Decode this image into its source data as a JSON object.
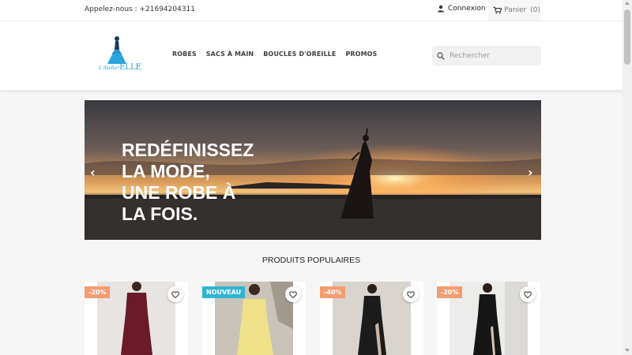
{
  "topbar": {
    "phone_text": "Appelez-nous : +21694204311",
    "login_label": "Connexion",
    "cart_label": "Panier",
    "cart_count": "(0)"
  },
  "header": {
    "logo_small": "L'Atelier",
    "logo_main": "ELLE",
    "nav": [
      "ROBES",
      "SACS À MAIN",
      "BOUCLES D'OREILLE",
      "PROMOS"
    ],
    "search_placeholder": "Rechercher"
  },
  "hero": {
    "caption": "REDÉFINISSEZ\nLA MODE,\nUNE ROBE À\nLA FOIS.",
    "prev_icon": "‹",
    "next_icon": "›"
  },
  "section": {
    "title": "PRODUITS POPULAIRES"
  },
  "products": [
    {
      "badge": "-20%",
      "badge_type": "discount",
      "dress_color": "#6b1a2a",
      "bg_color": "#e8e4e2"
    },
    {
      "badge": "NOUVEAU",
      "badge_type": "new",
      "dress_color": "#efe08a",
      "bg_color": "#c9c3ba"
    },
    {
      "badge": "-40%",
      "badge_type": "discount",
      "dress_color": "#1b1b1b",
      "bg_color": "#d9d4cd"
    },
    {
      "badge": "-20%",
      "badge_type": "discount",
      "dress_color": "#161616",
      "bg_color": "#ececea"
    }
  ],
  "colors": {
    "accent_blue": "#2fb5d2",
    "discount_orange": "#f39d72"
  }
}
